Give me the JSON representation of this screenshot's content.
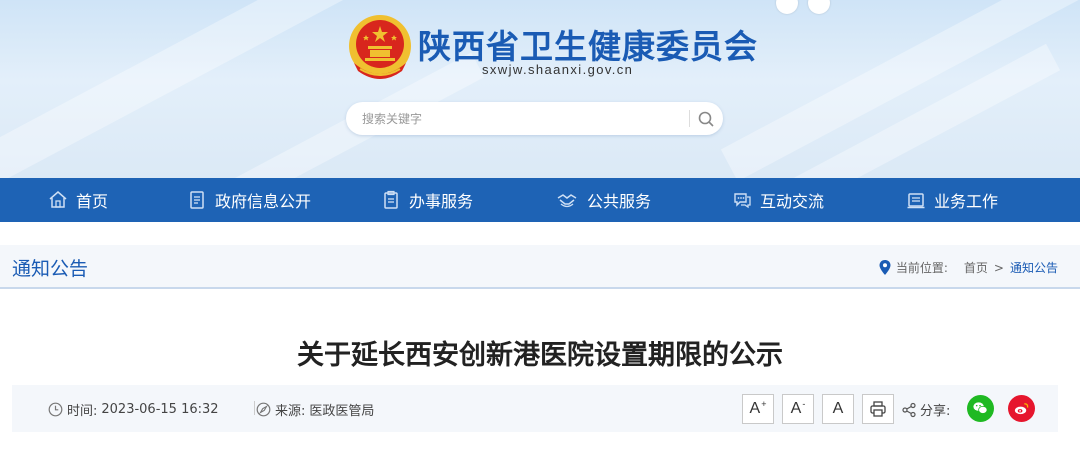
{
  "site": {
    "title": "陕西省卫生健康委员会",
    "domain": "sxwjw.shaanxi.gov.cn"
  },
  "search": {
    "placeholder": "搜索关键字",
    "value": ""
  },
  "nav": {
    "items": [
      {
        "label": "首页",
        "icon": "home-icon"
      },
      {
        "label": "政府信息公开",
        "icon": "document-list-icon"
      },
      {
        "label": "办事服务",
        "icon": "clipboard-icon"
      },
      {
        "label": "公共服务",
        "icon": "handshake-icon"
      },
      {
        "label": "互动交流",
        "icon": "chat-bubbles-icon"
      },
      {
        "label": "业务工作",
        "icon": "briefcase-icon"
      }
    ]
  },
  "section": {
    "title": "通知公告",
    "breadcrumb": {
      "prefix": "当前位置:",
      "home": "首页",
      "separator": ">",
      "current": "通知公告"
    }
  },
  "article": {
    "title": "关于延长西安创新港医院设置期限的公示",
    "time_label": "时间:",
    "time_value": "2023-06-15 16:32",
    "source_label": "来源:",
    "source_value": "医政医管局"
  },
  "tools": {
    "font_larger": "A",
    "font_larger_mark": "+",
    "font_smaller": "A",
    "font_smaller_mark": "-",
    "font_default": "A",
    "share_label": "分享:"
  },
  "colors": {
    "brand_blue": "#1e63b5",
    "title_blue": "#1a5bb4",
    "wechat_green": "#1fb922",
    "weibo_red": "#e6162d",
    "emblem_red": "#d8261d",
    "emblem_gold": "#f0c030"
  }
}
